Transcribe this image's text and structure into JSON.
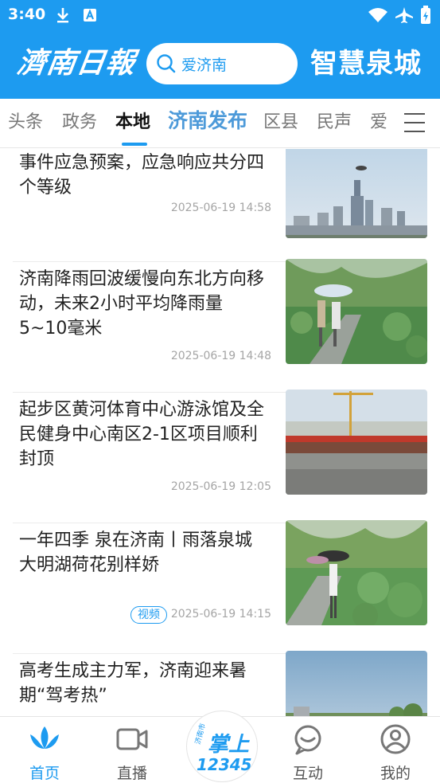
{
  "status": {
    "time": "3:40"
  },
  "header": {
    "logo_text": "濟南日報",
    "search_placeholder": "爱济南",
    "city_logo_text": "智慧泉城"
  },
  "tabs": [
    {
      "label": "头条"
    },
    {
      "label": "政务"
    },
    {
      "label": "本地"
    },
    {
      "label": "济南发布"
    },
    {
      "label": "区县"
    },
    {
      "label": "民声"
    },
    {
      "label": "爱"
    }
  ],
  "active_tab": "本地",
  "feed": [
    {
      "title": "事件应急预案，应急响应共分四个等级",
      "time": "2025-06-19 14:58",
      "badge": ""
    },
    {
      "title": "济南降雨回波缓慢向东北方向移动，未来2小时平均降雨量5~10毫米",
      "time": "2025-06-19 14:48",
      "badge": ""
    },
    {
      "title": "起步区黄河体育中心游泳馆及全民健身中心南区2-1区项目顺利封顶",
      "time": "2025-06-19 12:05",
      "badge": ""
    },
    {
      "title": "一年四季 泉在济南丨雨落泉城 大明湖荷花别样娇",
      "time": "2025-06-19 14:15",
      "badge": "视频"
    },
    {
      "title": "高考生成主力军，济南迎来暑期“驾考热”",
      "time": "",
      "badge": ""
    }
  ],
  "bottom_nav": {
    "home": "首页",
    "live": "直播",
    "center_logo_top": "济南市",
    "center_logo_main": "掌上",
    "center_logo_num": "12345",
    "interact": "互动",
    "mine": "我的"
  },
  "colors": {
    "brand_blue": "#1d9bf0",
    "featured_tab": "#4d9ad9"
  },
  "icons": {
    "status": [
      "download-icon",
      "app-a-icon",
      "wifi-icon",
      "airplane-icon",
      "battery-icon"
    ],
    "search": "search-icon",
    "menu": "menu-icon",
    "nav": [
      "lotus-home-icon",
      "video-camera-icon",
      "chat-bubble-icon",
      "user-circle-icon"
    ]
  }
}
